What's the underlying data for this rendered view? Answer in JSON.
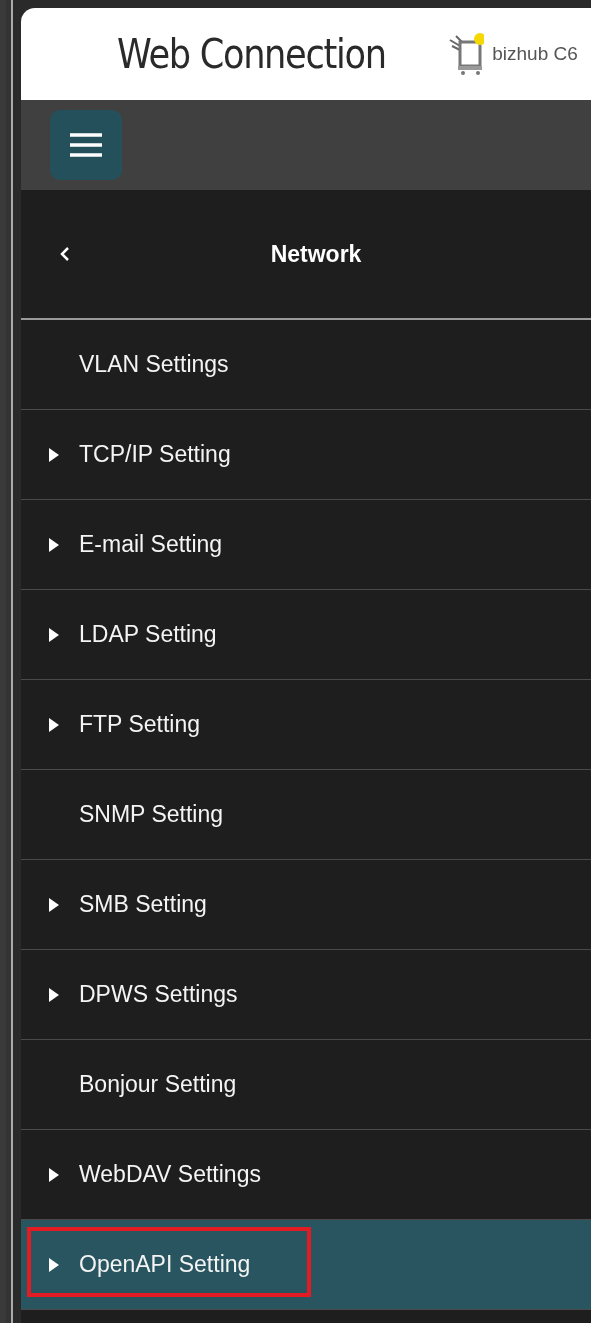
{
  "header": {
    "title": "Web Connection",
    "device": "bizhub C6"
  },
  "menu_panel": {
    "title": "Network",
    "items": [
      {
        "label": "VLAN Settings",
        "expandable": false,
        "selected": false,
        "highlighted": false
      },
      {
        "label": "TCP/IP Setting",
        "expandable": true,
        "selected": false,
        "highlighted": false
      },
      {
        "label": "E-mail Setting",
        "expandable": true,
        "selected": false,
        "highlighted": false
      },
      {
        "label": "LDAP Setting",
        "expandable": true,
        "selected": false,
        "highlighted": false
      },
      {
        "label": "FTP Setting",
        "expandable": true,
        "selected": false,
        "highlighted": false
      },
      {
        "label": "SNMP Setting",
        "expandable": false,
        "selected": false,
        "highlighted": false
      },
      {
        "label": "SMB Setting",
        "expandable": true,
        "selected": false,
        "highlighted": false
      },
      {
        "label": "DPWS Settings",
        "expandable": true,
        "selected": false,
        "highlighted": false
      },
      {
        "label": "Bonjour Setting",
        "expandable": false,
        "selected": false,
        "highlighted": false
      },
      {
        "label": "WebDAV Settings",
        "expandable": true,
        "selected": false,
        "highlighted": false
      },
      {
        "label": "OpenAPI Setting",
        "expandable": true,
        "selected": true,
        "highlighted": true
      }
    ]
  }
}
